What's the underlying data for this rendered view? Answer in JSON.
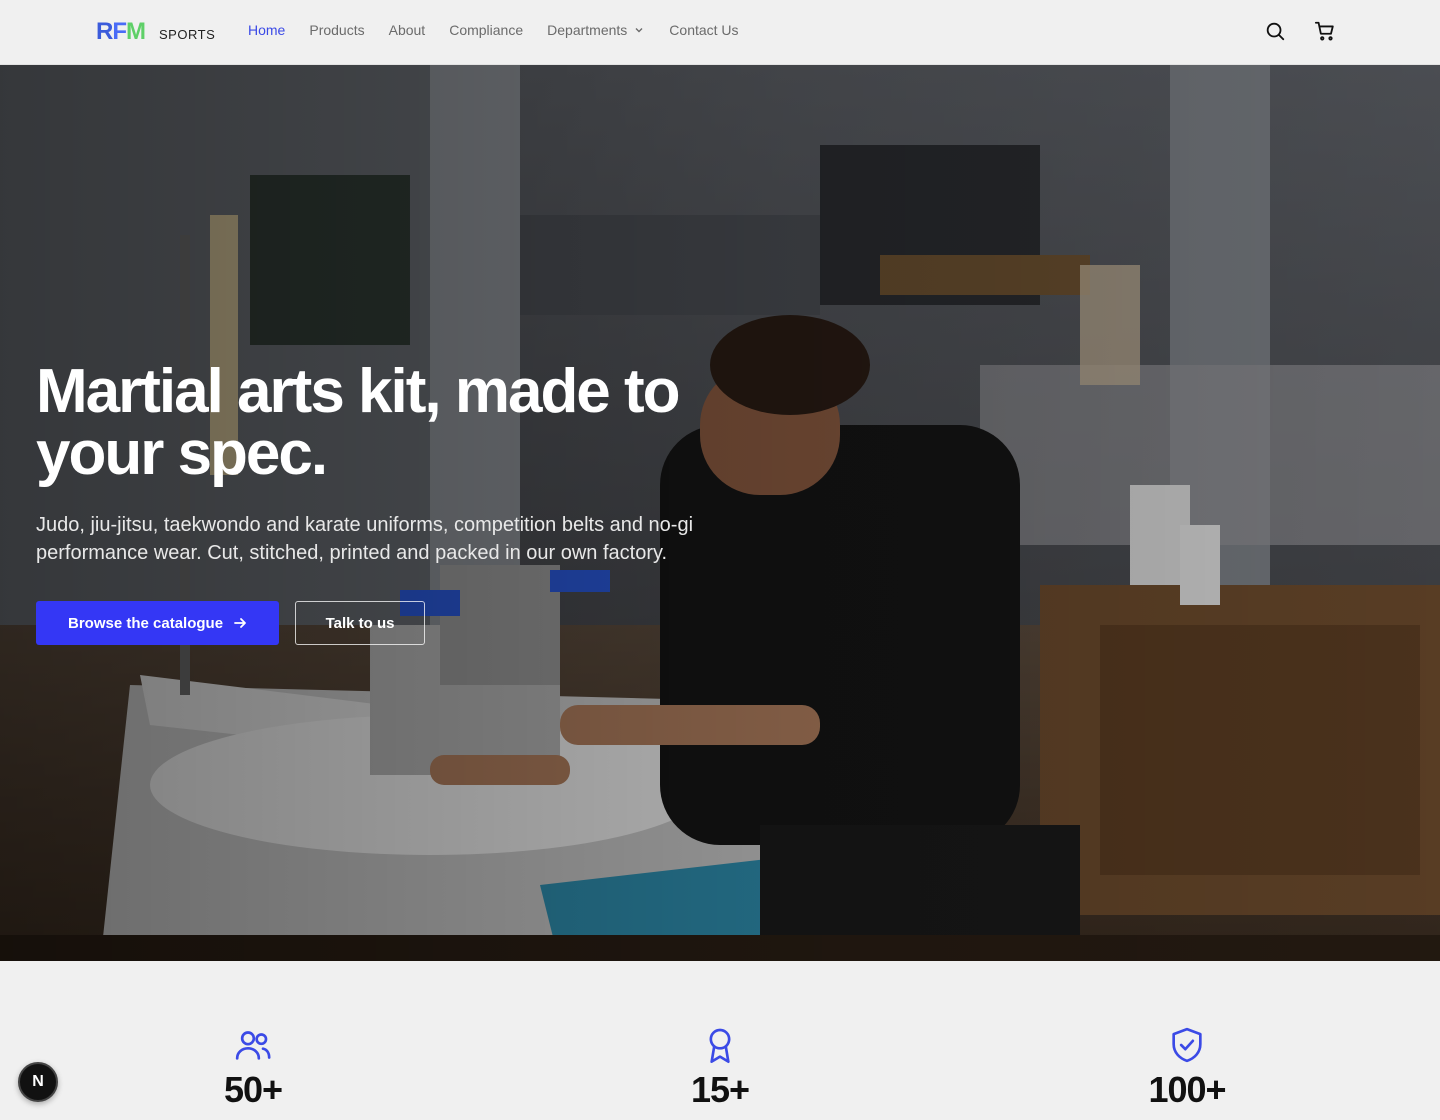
{
  "brand": {
    "mark_r": "R",
    "mark_f": "F",
    "mark_m": "M",
    "sub": "SPORTS"
  },
  "nav": {
    "items": [
      {
        "label": "Home",
        "active": true
      },
      {
        "label": "Products"
      },
      {
        "label": "About"
      },
      {
        "label": "Compliance"
      },
      {
        "label": "Departments",
        "dropdown": true
      },
      {
        "label": "Contact Us"
      }
    ],
    "icons": [
      "search-icon",
      "cart-icon"
    ]
  },
  "hero": {
    "title_line1": "Martial arts kit, made to",
    "title_line2": "your spec.",
    "description": "Judo, jiu-jitsu, taekwondo and karate uniforms, competition belts and no-gi performance wear. Cut, stitched, printed and packed in our own factory.",
    "primary_button": "Browse the catalogue",
    "secondary_button": "Talk to us"
  },
  "stats": [
    {
      "icon": "users-icon",
      "value": "50+"
    },
    {
      "icon": "award-icon",
      "value": "15+"
    },
    {
      "icon": "shield-check-icon",
      "value": "100+"
    }
  ],
  "dev_badge": {
    "letter": "N"
  },
  "colors": {
    "accent": "#3437f5",
    "link_active": "#3b4ae6",
    "logo_green": "#5fd068"
  }
}
